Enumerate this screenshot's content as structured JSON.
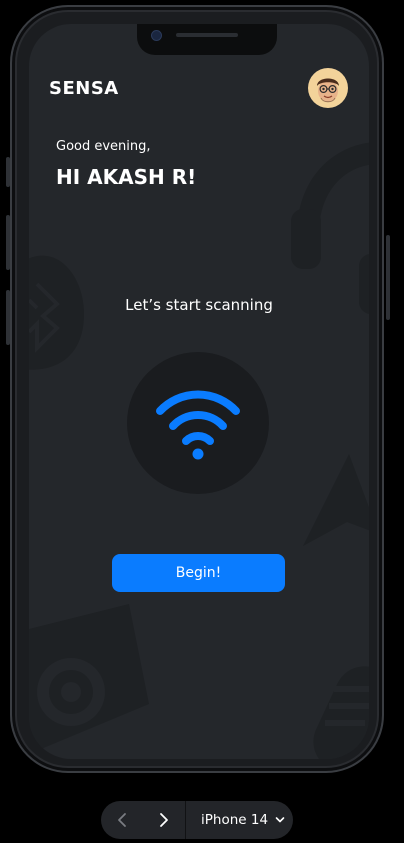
{
  "app": {
    "title": "SENSA",
    "avatar_icon": "memoji-avatar-icon"
  },
  "greeting": {
    "salutation": "Good evening,",
    "user_line": "HI AKASH R!"
  },
  "scan": {
    "title": "Let’s start scanning",
    "icon": "wifi-icon",
    "begin_label": "Begin!"
  },
  "device_toolbar": {
    "prev_icon": "chevron-left-icon",
    "next_icon": "chevron-right-icon",
    "device_label": "iPhone 14",
    "dropdown_icon": "chevron-down-icon"
  },
  "colors": {
    "screen_bg": "#24272b",
    "accent": "#0a7cff",
    "wifi_blue": "#0a7cff",
    "circle_bg": "#1a1c1f",
    "avatar_bg": "#f3d39a"
  }
}
